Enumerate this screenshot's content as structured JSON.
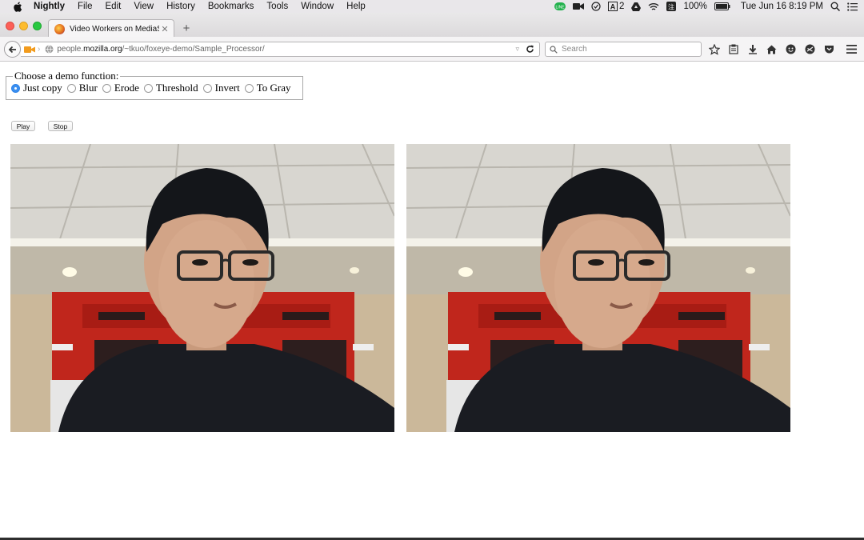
{
  "menubar": {
    "app_name": "Nightly",
    "items": [
      "File",
      "Edit",
      "View",
      "History",
      "Bookmarks",
      "Tools",
      "Window",
      "Help"
    ],
    "status": {
      "notification_count": "2",
      "battery": "100%",
      "datetime": "Tue Jun 16  8:19 PM"
    }
  },
  "browser": {
    "tab_title": "Video Workers on MediaStr...",
    "new_tab_label": "+",
    "url_host_prefix": "people.",
    "url_domain": "mozilla.org",
    "url_path": "/~tkuo/foxeye-demo/Sample_Processor/",
    "search_placeholder": "Search"
  },
  "page": {
    "legend": "Choose a demo function:",
    "options": [
      {
        "label": "Just copy",
        "checked": true
      },
      {
        "label": "Blur",
        "checked": false
      },
      {
        "label": "Erode",
        "checked": false
      },
      {
        "label": "Threshold",
        "checked": false
      },
      {
        "label": "Invert",
        "checked": false
      },
      {
        "label": "To Gray",
        "checked": false
      }
    ],
    "play_label": "Play",
    "stop_label": "Stop"
  },
  "colors": {
    "accent": "#3b8ff0",
    "wall_red": "#c0261c"
  }
}
